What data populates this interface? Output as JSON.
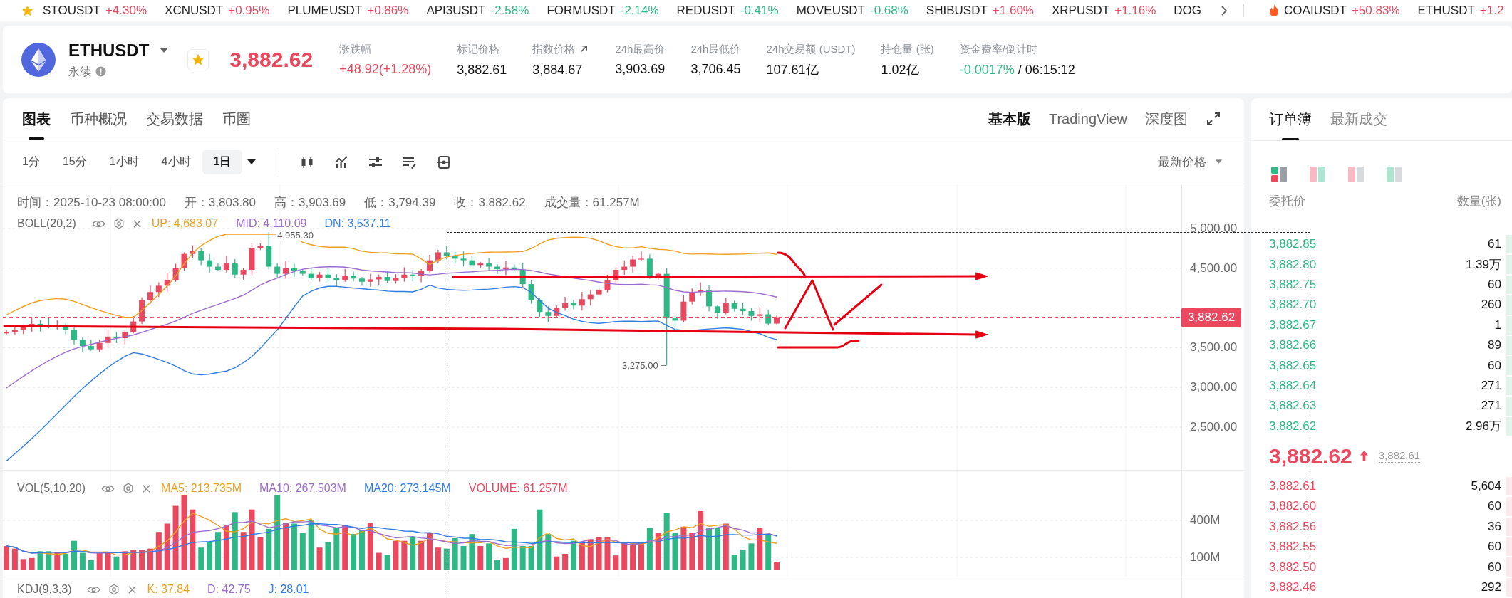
{
  "ticker": {
    "items": [
      {
        "symbol": "STOUSDT",
        "change": "+4.30%",
        "color": "#e9485f"
      },
      {
        "symbol": "XCNUSDT",
        "change": "+0.95%",
        "color": "#e9485f"
      },
      {
        "symbol": "PLUMEUSDT",
        "change": "+0.86%",
        "color": "#e9485f"
      },
      {
        "symbol": "API3USDT",
        "change": "-2.58%",
        "color": "#2db886"
      },
      {
        "symbol": "FORMUSDT",
        "change": "-2.14%",
        "color": "#2db886"
      },
      {
        "symbol": "REDUSDT",
        "change": "-0.41%",
        "color": "#2db886"
      },
      {
        "symbol": "MOVEUSDT",
        "change": "-0.68%",
        "color": "#2db886"
      },
      {
        "symbol": "SHIBUSDT",
        "change": "+1.60%",
        "color": "#e9485f"
      },
      {
        "symbol": "XRPUSDT",
        "change": "+1.16%",
        "color": "#e9485f"
      },
      {
        "symbol": "DOG"
      }
    ],
    "hot_items": [
      {
        "symbol": "COAIUSDT",
        "change": "+50.83%",
        "color": "#e9485f"
      },
      {
        "symbol": "ETHUSDT",
        "change": "+1.2",
        "color": "#e9485f"
      }
    ]
  },
  "market": {
    "symbol": "ETHUSDT",
    "contract_type": "永续",
    "favorite": true,
    "price": "3,882.62",
    "rising": true,
    "stats": [
      {
        "label": "涨跌幅",
        "value": "+48.92(+1.28%)",
        "color": "#e9485f",
        "tooltip": false,
        "link": false
      },
      {
        "label": "标记价格",
        "value": "3,882.61",
        "color": "#111111",
        "tooltip": true,
        "link": false
      },
      {
        "label": "指数价格",
        "value": "3,884.67",
        "color": "#111111",
        "tooltip": true,
        "link": true
      },
      {
        "label": "24h最高价",
        "value": "3,903.69",
        "color": "#111111",
        "tooltip": false,
        "link": false
      },
      {
        "label": "24h最低价",
        "value": "3,706.45",
        "color": "#111111",
        "tooltip": false,
        "link": false
      },
      {
        "label": "24h交易额 (USDT)",
        "value": "107.61亿",
        "color": "#111111",
        "tooltip": true,
        "link": false
      },
      {
        "label": "持仓量 (张)",
        "value": "1.02亿",
        "color": "#111111",
        "tooltip": true,
        "link": false
      },
      {
        "label": "资金费率/倒计时",
        "value": "-0.0017%",
        "suffix": "/ 06:15:12",
        "color": "#2db886",
        "tooltip": true,
        "link": false
      }
    ]
  },
  "chart_panel": {
    "tabs": [
      {
        "label": "图表",
        "selected": true
      },
      {
        "label": "币种概况",
        "selected": false
      },
      {
        "label": "交易数据",
        "selected": false
      },
      {
        "label": "币圈",
        "selected": false
      }
    ],
    "views": [
      {
        "label": "基本版",
        "selected": true
      },
      {
        "label": "TradingView",
        "selected": false
      },
      {
        "label": "深度图",
        "selected": false
      }
    ],
    "intervals": [
      {
        "label": "1分",
        "selected": false
      },
      {
        "label": "15分",
        "selected": false
      },
      {
        "label": "1小时",
        "selected": false
      },
      {
        "label": "4小时",
        "selected": false
      },
      {
        "label": "1日",
        "selected": true
      }
    ],
    "price_source": "最新价格",
    "candle_info": [
      "时间：2025-10-23 08:00:00",
      "开：3,803.80",
      "高：3,903.69",
      "低：3,794.39",
      "收：3,882.62",
      "成交量：61.257M"
    ],
    "indicators": [
      {
        "name": "BOLL(20,2)",
        "kind": "price",
        "values": [
          {
            "text": "UP: 4,683.07",
            "color": "#f0a020"
          },
          {
            "text": "MID: 4,110.09",
            "color": "#9c6ccc"
          },
          {
            "text": "DN: 3,537.11",
            "color": "#2f7ce6"
          }
        ]
      },
      {
        "name": "VOL(5,10,20)",
        "kind": "volume",
        "values": [
          {
            "text": "MA5: 213.735M",
            "color": "#f0a020"
          },
          {
            "text": "MA10: 267.503M",
            "color": "#9c6ccc"
          },
          {
            "text": "MA20: 273.145M",
            "color": "#2f7ce6"
          },
          {
            "text": "VOLUME: 61.257M",
            "color": "#e9485f"
          }
        ]
      },
      {
        "name": "KDJ(9,3,3)",
        "kind": "kdj",
        "values": [
          {
            "text": "K: 37.84",
            "color": "#f0a020"
          },
          {
            "text": "D: 42.75",
            "color": "#9c6ccc"
          },
          {
            "text": "J: 28.01",
            "color": "#2f7ce6"
          }
        ]
      }
    ],
    "price_axis": [
      "5,000.00",
      "4,500.00",
      "3,500.00",
      "3,000.00",
      "2,500.00"
    ],
    "last_price_tag": "3,882.62",
    "high_label": "4,955.30",
    "low_label": "3,275.00",
    "volume_axis": [
      "400M",
      "100M"
    ]
  },
  "order_book": {
    "tabs": [
      {
        "label": "订单簿",
        "selected": true
      },
      {
        "label": "最新成交",
        "selected": false
      }
    ],
    "layouts": [
      {
        "kind": "both",
        "selected": true
      },
      {
        "kind": "pair",
        "selected": false
      },
      {
        "kind": "bids",
        "selected": false
      },
      {
        "kind": "asks",
        "selected": false
      }
    ],
    "columns": [
      "委托价",
      "数量(张)"
    ],
    "asks": [
      {
        "price": "3,882.85",
        "amount": "61"
      },
      {
        "price": "3,882.80",
        "amount": "1.39万"
      },
      {
        "price": "3,882.75",
        "amount": "60"
      },
      {
        "price": "3,882.70",
        "amount": "260"
      },
      {
        "price": "3,882.67",
        "amount": "1"
      },
      {
        "price": "3,882.66",
        "amount": "89"
      },
      {
        "price": "3,882.65",
        "amount": "60"
      },
      {
        "price": "3,882.64",
        "amount": "271"
      },
      {
        "price": "3,882.63",
        "amount": "271"
      },
      {
        "price": "3,882.62",
        "amount": "2.96万"
      }
    ],
    "last": {
      "price": "3,882.62",
      "rising": true,
      "mark_price": "3,882.61"
    },
    "bids": [
      {
        "price": "3,882.61",
        "amount": "5,604"
      },
      {
        "price": "3,882.60",
        "amount": "60"
      },
      {
        "price": "3,882.56",
        "amount": "36"
      },
      {
        "price": "3,882.55",
        "amount": "60"
      },
      {
        "price": "3,882.50",
        "amount": "60"
      },
      {
        "price": "3,882.46",
        "amount": "292"
      }
    ]
  }
}
